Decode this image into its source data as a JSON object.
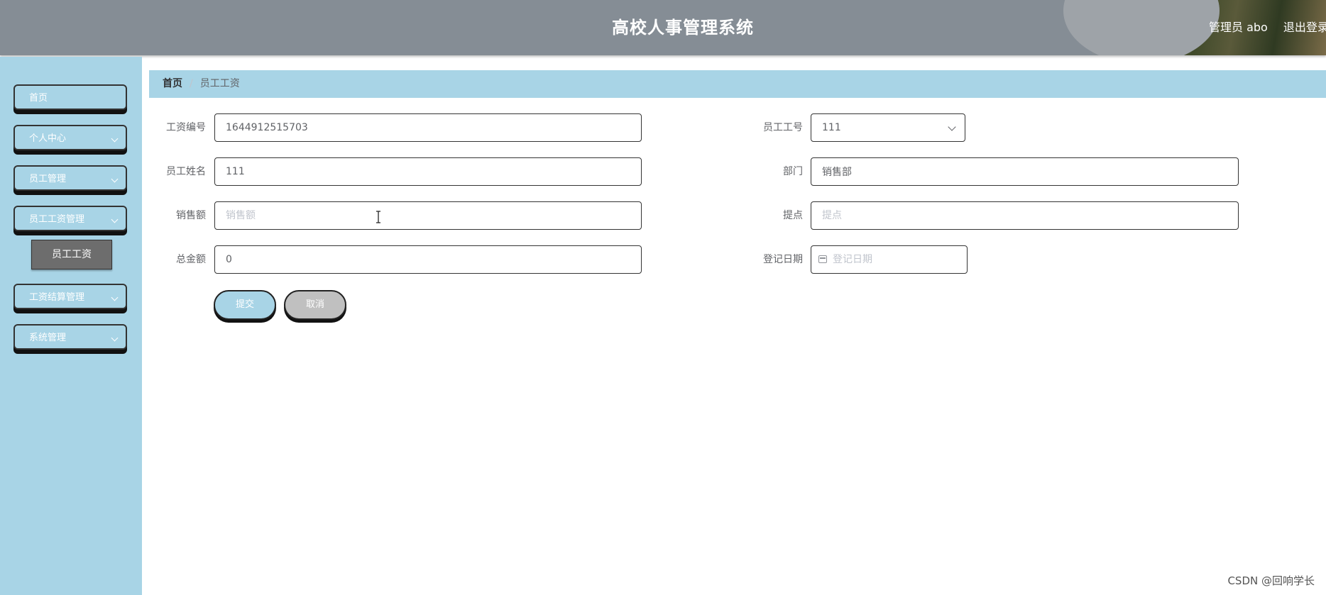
{
  "header": {
    "title": "高校人事管理系统",
    "user_label": "管理员 abo",
    "logout_label": "退出登录"
  },
  "sidebar": {
    "items": [
      {
        "label": "首页"
      },
      {
        "label": "个人中心"
      },
      {
        "label": "员工管理"
      },
      {
        "label": "员工工资管理"
      },
      {
        "label": "工资结算管理"
      },
      {
        "label": "系统管理"
      }
    ],
    "active_sub": {
      "label": "员工工资"
    }
  },
  "breadcrumb": {
    "home": "首页",
    "separator": "/",
    "current": "员工工资"
  },
  "form": {
    "salary_id": {
      "label": "工资编号",
      "value": "1644912515703"
    },
    "employee_no": {
      "label": "员工工号",
      "value": "111"
    },
    "employee_name": {
      "label": "员工姓名",
      "value": "111"
    },
    "department": {
      "label": "部门",
      "value": "销售部"
    },
    "sales": {
      "label": "销售额",
      "placeholder": "销售额",
      "value": ""
    },
    "commission": {
      "label": "提点",
      "placeholder": "提点",
      "value": ""
    },
    "total": {
      "label": "总金额",
      "value": "0"
    },
    "register_date": {
      "label": "登记日期",
      "placeholder": "登记日期"
    }
  },
  "buttons": {
    "submit": "提交",
    "cancel": "取消"
  },
  "watermark": "CSDN @回响学长",
  "colors": {
    "header_bg": "#858d95",
    "sidebar_bg": "#a8d4e6",
    "cancel_bg": "#c0c0c0",
    "active_sub_bg": "#6d6d6d"
  }
}
